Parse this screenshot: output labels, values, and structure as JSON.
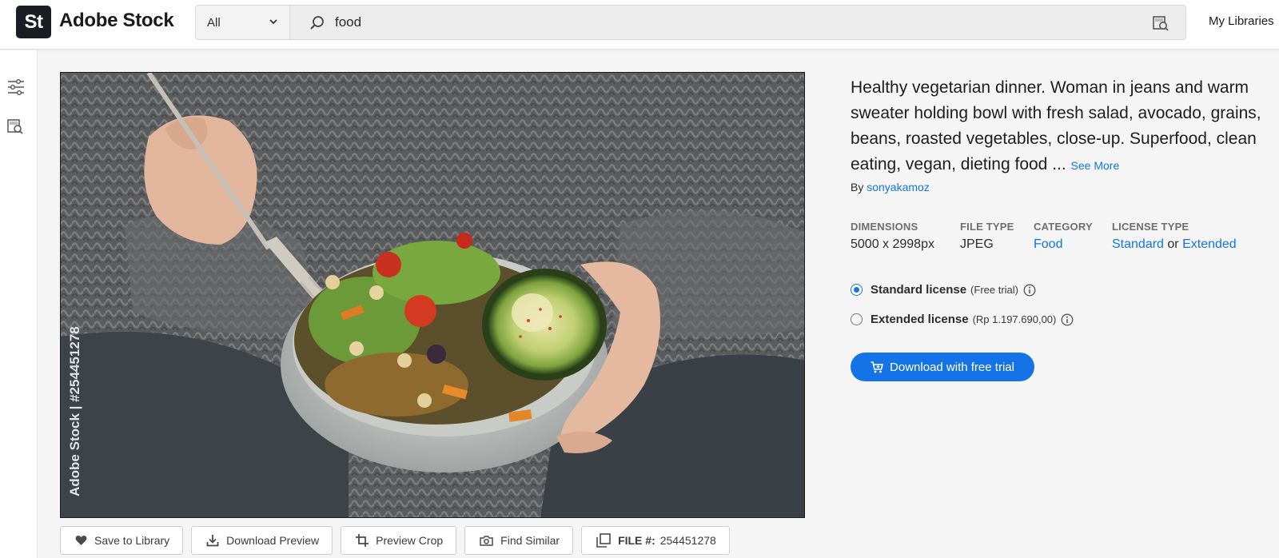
{
  "header": {
    "logo_text": "St",
    "brand": "Adobe Stock",
    "search_scope": "All",
    "search_query": "food",
    "my_libraries": "My Libraries"
  },
  "asset": {
    "title": "Healthy vegetarian dinner. Woman in jeans and warm sweater holding bowl with fresh salad, avocado, grains, beans, roasted vegetables, close-up. Superfood, clean eating, vegan, dieting food ...",
    "see_more": "See More",
    "by_prefix": "By",
    "author": "sonyakamoz",
    "watermark_side": "Adobe Stock | #254451278",
    "meta": {
      "dimensions_label": "DIMENSIONS",
      "dimensions_value": "5000 x 2998px",
      "file_type_label": "FILE TYPE",
      "file_type_value": "JPEG",
      "category_label": "CATEGORY",
      "category_value": "Food",
      "license_type_label": "LICENSE TYPE",
      "license_standard": "Standard",
      "license_or": "or",
      "license_extended": "Extended"
    }
  },
  "licenses": [
    {
      "name": "Standard license",
      "price": "(Free trial)",
      "selected": true
    },
    {
      "name": "Extended license",
      "price": "(Rp 1.197.690,00)",
      "selected": false
    }
  ],
  "download_button": "Download with free trial",
  "actions": {
    "save_to_library": "Save to Library",
    "download_preview": "Download Preview",
    "preview_crop": "Preview Crop",
    "find_similar": "Find Similar",
    "file_label": "FILE #:",
    "file_number": "254451278"
  },
  "colors": {
    "accent": "#1473e6",
    "logo_bg": "#1a1d21"
  }
}
